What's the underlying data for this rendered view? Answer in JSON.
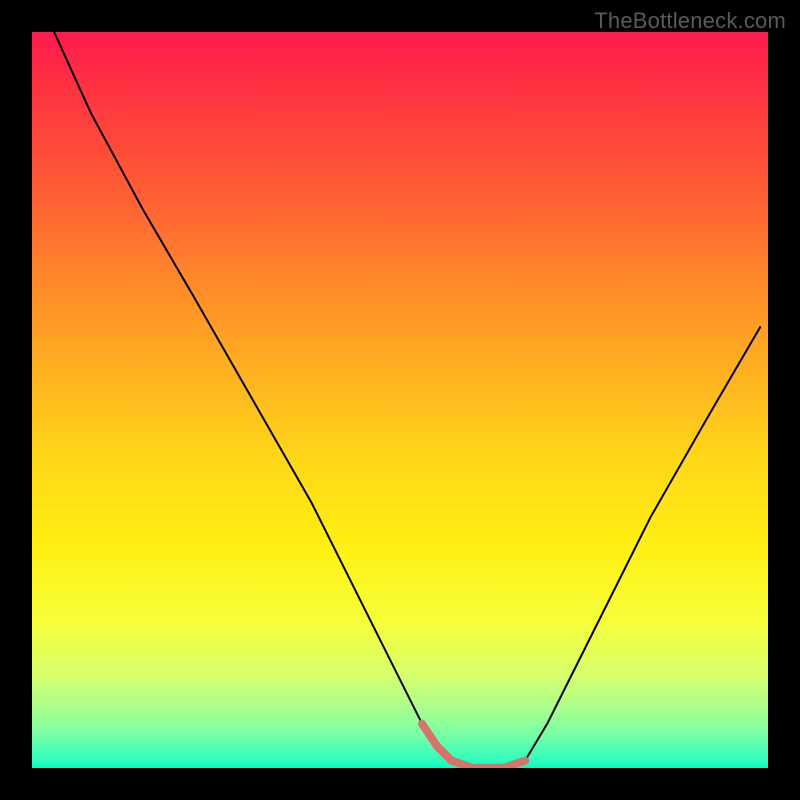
{
  "watermark": "TheBottleneck.com",
  "chart_data": {
    "type": "line",
    "title": "",
    "xlabel": "",
    "ylabel": "",
    "xlim": [
      0,
      100
    ],
    "ylim": [
      0,
      100
    ],
    "grid": false,
    "legend": false,
    "background_gradient": {
      "top": "#ff1a4d",
      "middle": "#ffd718",
      "bottom": "#00ffbe"
    },
    "series": [
      {
        "name": "bottleneck-curve",
        "stroke": "#000000",
        "stroke_width": 2,
        "x": [
          3,
          8,
          15,
          22,
          30,
          38,
          45,
          50,
          53,
          55,
          57,
          60,
          64,
          67,
          70,
          76,
          84,
          92,
          99
        ],
        "y": [
          100,
          89,
          76,
          64,
          50,
          36,
          22,
          12,
          6,
          3,
          1,
          0,
          0,
          1,
          6,
          18,
          34,
          48,
          60
        ]
      },
      {
        "name": "bottleneck-bottom-highlight",
        "stroke": "#d6736b",
        "stroke_width": 8,
        "x": [
          53,
          55,
          57,
          60,
          64,
          67
        ],
        "y": [
          6,
          3,
          1,
          0,
          0,
          1
        ]
      }
    ],
    "annotations": [
      {
        "type": "watermark",
        "text": "TheBottleneck.com",
        "position": "top-right"
      }
    ]
  }
}
